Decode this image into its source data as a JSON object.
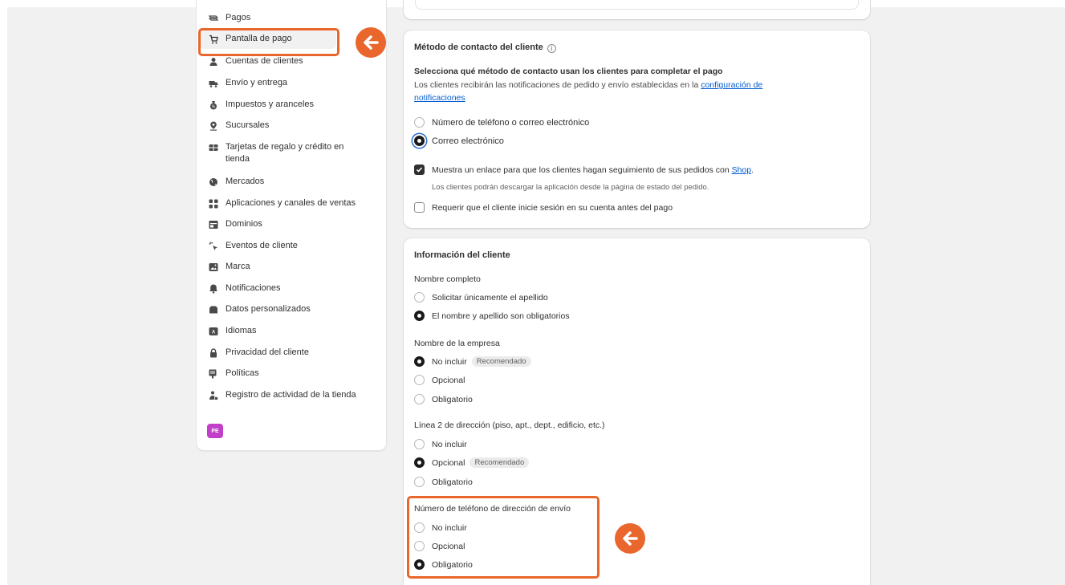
{
  "sidebar": {
    "items": [
      {
        "label": "Pagos",
        "icon": "cash-icon"
      },
      {
        "label": "Pantalla de pago",
        "icon": "cart-icon"
      },
      {
        "label": "Cuentas de clientes",
        "icon": "person-icon"
      },
      {
        "label": "Envío y entrega",
        "icon": "truck-icon"
      },
      {
        "label": "Impuestos y aranceles",
        "icon": "tax-icon"
      },
      {
        "label": "Sucursales",
        "icon": "location-icon"
      },
      {
        "label": "Tarjetas de regalo y crédito en tienda",
        "icon": "gift-card-icon"
      },
      {
        "label": "Mercados",
        "icon": "globe-icon"
      },
      {
        "label": "Aplicaciones y canales de ventas",
        "icon": "apps-icon"
      },
      {
        "label": "Dominios",
        "icon": "domain-icon"
      },
      {
        "label": "Eventos de cliente",
        "icon": "cursor-click-icon"
      },
      {
        "label": "Marca",
        "icon": "brand-icon"
      },
      {
        "label": "Notificaciones",
        "icon": "bell-icon"
      },
      {
        "label": "Datos personalizados",
        "icon": "database-icon"
      },
      {
        "label": "Idiomas",
        "icon": "language-icon"
      },
      {
        "label": "Privacidad del cliente",
        "icon": "lock-icon"
      },
      {
        "label": "Políticas",
        "icon": "policy-icon"
      },
      {
        "label": "Registro de actividad de la tienda",
        "icon": "activity-log-icon"
      }
    ],
    "avatar_initials": "PE"
  },
  "contact": {
    "title": "Método de contacto del cliente",
    "subtitle": "Selecciona qué método de contacto usan los clientes para completar el pago",
    "desc_prefix": "Los clientes recibirán las notificaciones de pedido y envío establecidas en la ",
    "desc_link_1": "configuración de",
    "desc_link_2": "notificaciones",
    "options": [
      "Número de teléfono o correo electrónico",
      "Correo electrónico"
    ],
    "selected": 1,
    "track_prefix": "Muestra un enlace para que los clientes hagan seguimiento de sus pedidos con ",
    "track_link": "Shop",
    "track_suffix": ".",
    "track_help": "Los clientes podrán descargar la aplicación desde la página de estado del pedido.",
    "track_checked": true,
    "login_label": "Requerir que el cliente inicie sesión en su cuenta antes del pago",
    "login_checked": false
  },
  "info": {
    "title": "Información del cliente",
    "full_name": {
      "label": "Nombre completo",
      "options": [
        "Solicitar únicamente el apellido",
        "El nombre y apellido son obligatorios"
      ],
      "selected": 1
    },
    "company": {
      "label": "Nombre de la empresa",
      "options": [
        "No incluir",
        "Opcional",
        "Obligatorio"
      ],
      "selected": 0,
      "badge": "Recomendado"
    },
    "address2": {
      "label": "Línea 2 de dirección (piso, apt., dept., edificio, etc.)",
      "options": [
        "No incluir",
        "Opcional",
        "Obligatorio"
      ],
      "selected": 1,
      "badge": "Recomendado"
    },
    "phone": {
      "label": "Número de teléfono de dirección de envío",
      "options": [
        "No incluir",
        "Opcional",
        "Obligatorio"
      ],
      "selected": 2
    }
  },
  "colors": {
    "accent": "#e9662c",
    "link": "#005bd3",
    "avatar": "#c13fc9"
  }
}
